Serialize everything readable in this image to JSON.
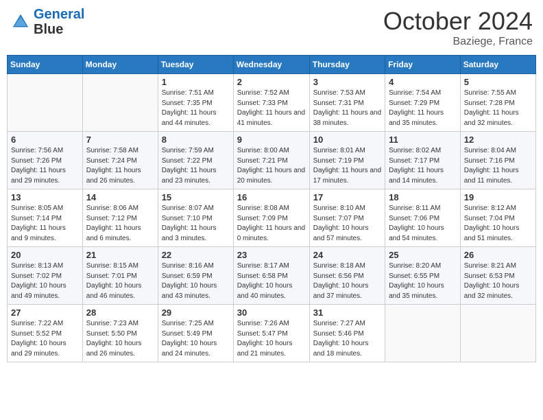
{
  "header": {
    "logo_line1": "General",
    "logo_line2": "Blue",
    "month": "October 2024",
    "location": "Baziege, France"
  },
  "weekdays": [
    "Sunday",
    "Monday",
    "Tuesday",
    "Wednesday",
    "Thursday",
    "Friday",
    "Saturday"
  ],
  "weeks": [
    [
      {
        "day": "",
        "sunrise": "",
        "sunset": "",
        "daylight": ""
      },
      {
        "day": "",
        "sunrise": "",
        "sunset": "",
        "daylight": ""
      },
      {
        "day": "1",
        "sunrise": "Sunrise: 7:51 AM",
        "sunset": "Sunset: 7:35 PM",
        "daylight": "Daylight: 11 hours and 44 minutes."
      },
      {
        "day": "2",
        "sunrise": "Sunrise: 7:52 AM",
        "sunset": "Sunset: 7:33 PM",
        "daylight": "Daylight: 11 hours and 41 minutes."
      },
      {
        "day": "3",
        "sunrise": "Sunrise: 7:53 AM",
        "sunset": "Sunset: 7:31 PM",
        "daylight": "Daylight: 11 hours and 38 minutes."
      },
      {
        "day": "4",
        "sunrise": "Sunrise: 7:54 AM",
        "sunset": "Sunset: 7:29 PM",
        "daylight": "Daylight: 11 hours and 35 minutes."
      },
      {
        "day": "5",
        "sunrise": "Sunrise: 7:55 AM",
        "sunset": "Sunset: 7:28 PM",
        "daylight": "Daylight: 11 hours and 32 minutes."
      }
    ],
    [
      {
        "day": "6",
        "sunrise": "Sunrise: 7:56 AM",
        "sunset": "Sunset: 7:26 PM",
        "daylight": "Daylight: 11 hours and 29 minutes."
      },
      {
        "day": "7",
        "sunrise": "Sunrise: 7:58 AM",
        "sunset": "Sunset: 7:24 PM",
        "daylight": "Daylight: 11 hours and 26 minutes."
      },
      {
        "day": "8",
        "sunrise": "Sunrise: 7:59 AM",
        "sunset": "Sunset: 7:22 PM",
        "daylight": "Daylight: 11 hours and 23 minutes."
      },
      {
        "day": "9",
        "sunrise": "Sunrise: 8:00 AM",
        "sunset": "Sunset: 7:21 PM",
        "daylight": "Daylight: 11 hours and 20 minutes."
      },
      {
        "day": "10",
        "sunrise": "Sunrise: 8:01 AM",
        "sunset": "Sunset: 7:19 PM",
        "daylight": "Daylight: 11 hours and 17 minutes."
      },
      {
        "day": "11",
        "sunrise": "Sunrise: 8:02 AM",
        "sunset": "Sunset: 7:17 PM",
        "daylight": "Daylight: 11 hours and 14 minutes."
      },
      {
        "day": "12",
        "sunrise": "Sunrise: 8:04 AM",
        "sunset": "Sunset: 7:16 PM",
        "daylight": "Daylight: 11 hours and 11 minutes."
      }
    ],
    [
      {
        "day": "13",
        "sunrise": "Sunrise: 8:05 AM",
        "sunset": "Sunset: 7:14 PM",
        "daylight": "Daylight: 11 hours and 9 minutes."
      },
      {
        "day": "14",
        "sunrise": "Sunrise: 8:06 AM",
        "sunset": "Sunset: 7:12 PM",
        "daylight": "Daylight: 11 hours and 6 minutes."
      },
      {
        "day": "15",
        "sunrise": "Sunrise: 8:07 AM",
        "sunset": "Sunset: 7:10 PM",
        "daylight": "Daylight: 11 hours and 3 minutes."
      },
      {
        "day": "16",
        "sunrise": "Sunrise: 8:08 AM",
        "sunset": "Sunset: 7:09 PM",
        "daylight": "Daylight: 11 hours and 0 minutes."
      },
      {
        "day": "17",
        "sunrise": "Sunrise: 8:10 AM",
        "sunset": "Sunset: 7:07 PM",
        "daylight": "Daylight: 10 hours and 57 minutes."
      },
      {
        "day": "18",
        "sunrise": "Sunrise: 8:11 AM",
        "sunset": "Sunset: 7:06 PM",
        "daylight": "Daylight: 10 hours and 54 minutes."
      },
      {
        "day": "19",
        "sunrise": "Sunrise: 8:12 AM",
        "sunset": "Sunset: 7:04 PM",
        "daylight": "Daylight: 10 hours and 51 minutes."
      }
    ],
    [
      {
        "day": "20",
        "sunrise": "Sunrise: 8:13 AM",
        "sunset": "Sunset: 7:02 PM",
        "daylight": "Daylight: 10 hours and 49 minutes."
      },
      {
        "day": "21",
        "sunrise": "Sunrise: 8:15 AM",
        "sunset": "Sunset: 7:01 PM",
        "daylight": "Daylight: 10 hours and 46 minutes."
      },
      {
        "day": "22",
        "sunrise": "Sunrise: 8:16 AM",
        "sunset": "Sunset: 6:59 PM",
        "daylight": "Daylight: 10 hours and 43 minutes."
      },
      {
        "day": "23",
        "sunrise": "Sunrise: 8:17 AM",
        "sunset": "Sunset: 6:58 PM",
        "daylight": "Daylight: 10 hours and 40 minutes."
      },
      {
        "day": "24",
        "sunrise": "Sunrise: 8:18 AM",
        "sunset": "Sunset: 6:56 PM",
        "daylight": "Daylight: 10 hours and 37 minutes."
      },
      {
        "day": "25",
        "sunrise": "Sunrise: 8:20 AM",
        "sunset": "Sunset: 6:55 PM",
        "daylight": "Daylight: 10 hours and 35 minutes."
      },
      {
        "day": "26",
        "sunrise": "Sunrise: 8:21 AM",
        "sunset": "Sunset: 6:53 PM",
        "daylight": "Daylight: 10 hours and 32 minutes."
      }
    ],
    [
      {
        "day": "27",
        "sunrise": "Sunrise: 7:22 AM",
        "sunset": "Sunset: 5:52 PM",
        "daylight": "Daylight: 10 hours and 29 minutes."
      },
      {
        "day": "28",
        "sunrise": "Sunrise: 7:23 AM",
        "sunset": "Sunset: 5:50 PM",
        "daylight": "Daylight: 10 hours and 26 minutes."
      },
      {
        "day": "29",
        "sunrise": "Sunrise: 7:25 AM",
        "sunset": "Sunset: 5:49 PM",
        "daylight": "Daylight: 10 hours and 24 minutes."
      },
      {
        "day": "30",
        "sunrise": "Sunrise: 7:26 AM",
        "sunset": "Sunset: 5:47 PM",
        "daylight": "Daylight: 10 hours and 21 minutes."
      },
      {
        "day": "31",
        "sunrise": "Sunrise: 7:27 AM",
        "sunset": "Sunset: 5:46 PM",
        "daylight": "Daylight: 10 hours and 18 minutes."
      },
      {
        "day": "",
        "sunrise": "",
        "sunset": "",
        "daylight": ""
      },
      {
        "day": "",
        "sunrise": "",
        "sunset": "",
        "daylight": ""
      }
    ]
  ]
}
